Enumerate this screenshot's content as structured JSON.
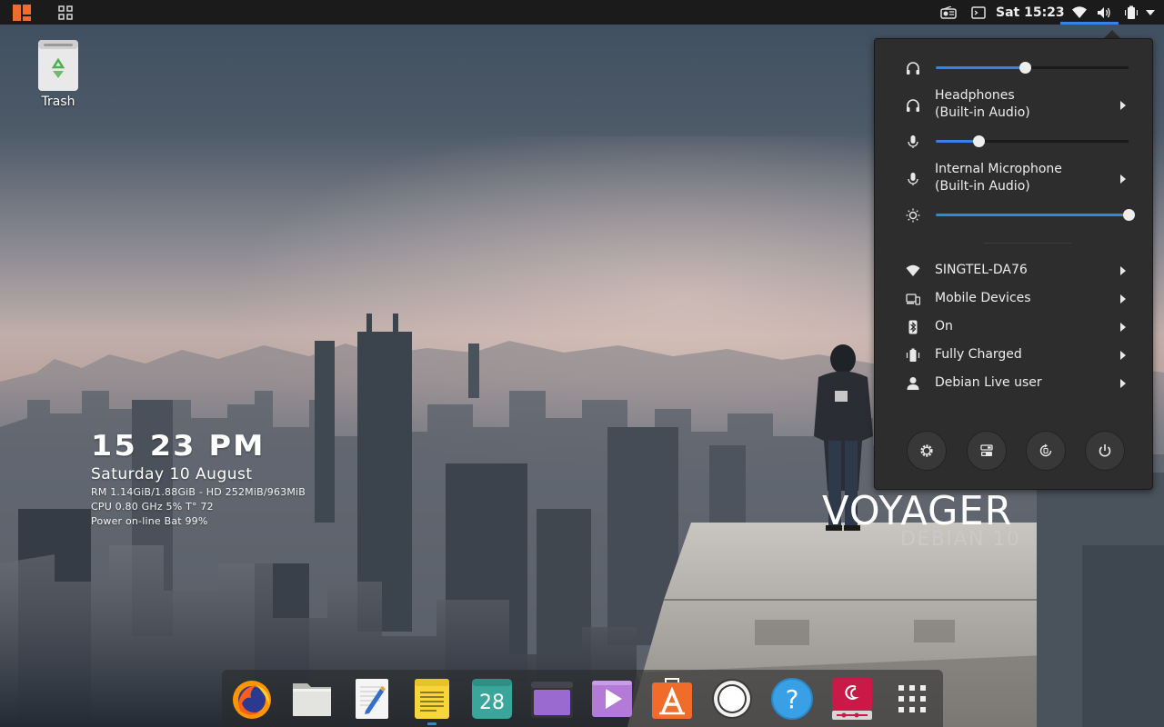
{
  "topbar": {
    "clock": "Sat 15:23",
    "accent_color": "#3584e4",
    "left_icons": [
      "activities-logo-icon",
      "app-grid-icon"
    ],
    "right_icons": [
      "media-icon",
      "terminal-icon",
      "wifi-icon",
      "volume-icon",
      "battery-icon",
      "dropdown-arrow-icon"
    ]
  },
  "desktop": {
    "trash_label": "Trash"
  },
  "conky": {
    "time": "15 23 PM",
    "date": "Saturday 10 August",
    "mem_line": "RM 1.14GiB/1.88GiB - HD 252MiB/963MiB",
    "cpu_line": "CPU 0.80 GHz 5% T° 72",
    "power_line": "Power on-line Bat 99%"
  },
  "branding": {
    "title": "VOYAGER",
    "subtitle": "DEBIAN 10"
  },
  "system_menu": {
    "volume_level": 0.46,
    "output_device": {
      "line1": "Headphones",
      "line2": "(Built-in Audio)"
    },
    "mic_level": 0.22,
    "input_device": {
      "line1": "Internal Microphone",
      "line2": "(Built-in Audio)"
    },
    "brightness_level": 1.0,
    "items": [
      {
        "icon": "wifi-icon",
        "label": "SINGTEL-DA76"
      },
      {
        "icon": "mobile-devices-icon",
        "label": "Mobile Devices"
      },
      {
        "icon": "bluetooth-icon",
        "label": "On"
      },
      {
        "icon": "battery-icon",
        "label": "Fully Charged"
      },
      {
        "icon": "user-icon",
        "label": "Debian Live user"
      }
    ],
    "buttons": [
      "settings-icon",
      "tweaks-icon",
      "screen-rotation-icon",
      "power-icon"
    ]
  },
  "dock": {
    "apps": [
      "firefox",
      "files",
      "text-editor",
      "notes",
      "calendar",
      "screenshot",
      "videos",
      "software",
      "cheese",
      "help",
      "debian-installer",
      "show-applications"
    ],
    "calendar_day": "28"
  }
}
